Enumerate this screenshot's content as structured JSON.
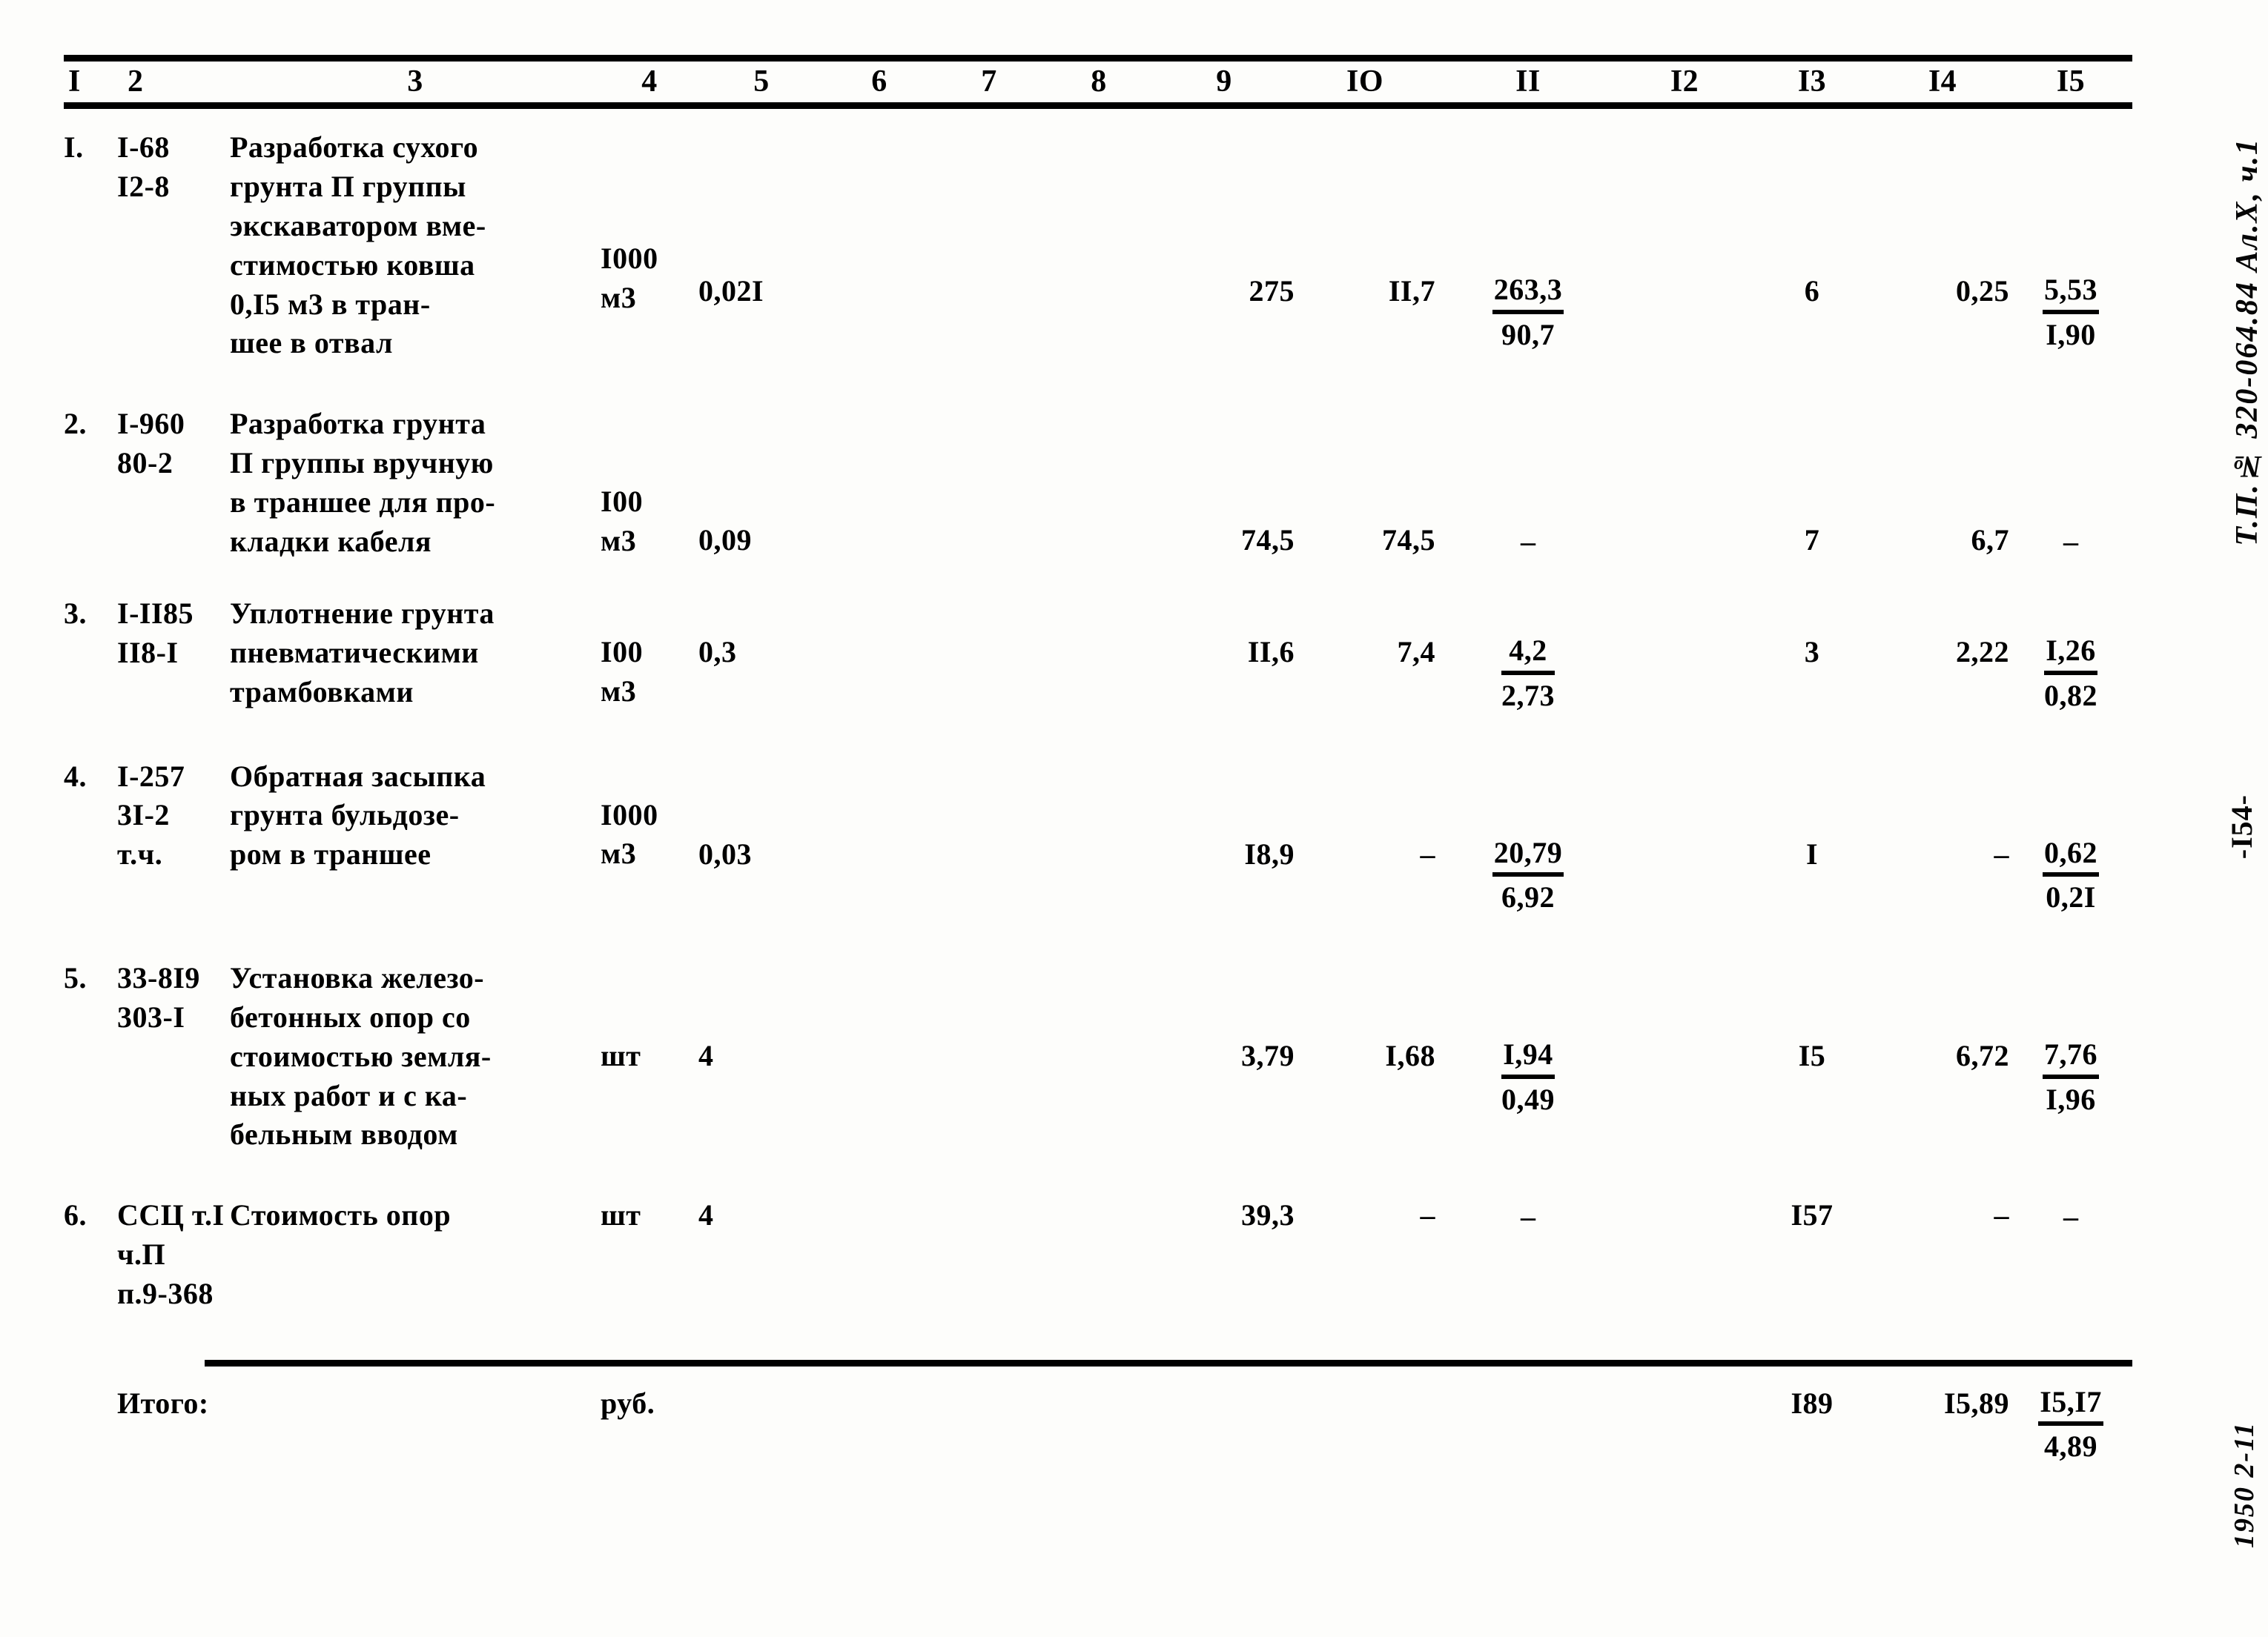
{
  "document": {
    "margin_reference": "Т.П.№ 320-064.84  Ал.Х, ч.1",
    "page_number": "-I54-",
    "archive_stamp": "1950 2-11"
  },
  "table": {
    "column_headers": [
      "I",
      "2",
      "3",
      "4",
      "5",
      "6",
      "7",
      "8",
      "9",
      "IO",
      "II",
      "I2",
      "I3",
      "I4",
      "I5"
    ],
    "rows": [
      {
        "index": "I.",
        "code": "I-68\nI2-8",
        "description": "Разработка сухого\nгрунта П группы\nэкскаватором вме-\nстимостью ковша\n0,I5 м3 в тран-\nшее в отвал",
        "unit": "I000\nм3",
        "quantity": "0,02I",
        "col6": "",
        "col7": "",
        "col8": "",
        "col9": "275",
        "col10": "II,7",
        "col11_top": "263,3",
        "col11_bottom": "90,7",
        "col12": "",
        "col13": "6",
        "col14": "0,25",
        "col15_top": "5,53",
        "col15_bottom": "I,90"
      },
      {
        "index": "2.",
        "code": "I-960\n80-2",
        "description": "Разработка грунта\nП группы вручную\nв траншее для про-\nкладки кабеля",
        "unit": "I00\nм3",
        "quantity": "0,09",
        "col6": "",
        "col7": "",
        "col8": "",
        "col9": "74,5",
        "col10": "74,5",
        "col11_top": "–",
        "col11_bottom": "",
        "col12": "",
        "col13": "7",
        "col14": "6,7",
        "col15_top": "–",
        "col15_bottom": ""
      },
      {
        "index": "3.",
        "code": "I-II85\nII8-I",
        "description": "Уплотнение грунта\nпневматическими\nтрамбовками",
        "unit": "I00\nм3",
        "quantity": "0,3",
        "col6": "",
        "col7": "",
        "col8": "",
        "col9": "II,6",
        "col10": "7,4",
        "col11_top": "4,2",
        "col11_bottom": "2,73",
        "col12": "",
        "col13": "3",
        "col14": "2,22",
        "col15_top": "I,26",
        "col15_bottom": "0,82"
      },
      {
        "index": "4.",
        "code": "I-257\n3I-2\nт.ч.",
        "description": "Обратная засыпка\nгрунта бульдозе-\nром в траншее",
        "unit": "I000\nм3",
        "quantity": "0,03",
        "col6": "",
        "col7": "",
        "col8": "",
        "col9": "I8,9",
        "col10": "–",
        "col11_top": "20,79",
        "col11_bottom": "6,92",
        "col12": "",
        "col13": "I",
        "col14": "–",
        "col15_top": "0,62",
        "col15_bottom": "0,2I"
      },
      {
        "index": "5.",
        "code": "33-8I9\n303-I",
        "description": "Установка железо-\nбетонных опор со\nстоимостью земля-\nных работ и с ка-\nбельным вводом",
        "unit": "шт",
        "quantity": "4",
        "col6": "",
        "col7": "",
        "col8": "",
        "col9": "3,79",
        "col10": "I,68",
        "col11_top": "I,94",
        "col11_bottom": "0,49",
        "col12": "",
        "col13": "I5",
        "col14": "6,72",
        "col15_top": "7,76",
        "col15_bottom": "I,96"
      },
      {
        "index": "6.",
        "code": "ССЦ т.I\nч.П\nп.9-368",
        "description": "Стоимость опор",
        "unit": "шт",
        "quantity": "4",
        "col6": "",
        "col7": "",
        "col8": "",
        "col9": "39,3",
        "col10": "–",
        "col11_top": "–",
        "col11_bottom": "",
        "col12": "",
        "col13": "I57",
        "col14": "–",
        "col15_top": "–",
        "col15_bottom": ""
      }
    ],
    "total": {
      "label": "Итого:",
      "unit": "руб.",
      "col13": "I89",
      "col14": "I5,89",
      "col15_top": "I5,I7",
      "col15_bottom": "4,89"
    }
  }
}
